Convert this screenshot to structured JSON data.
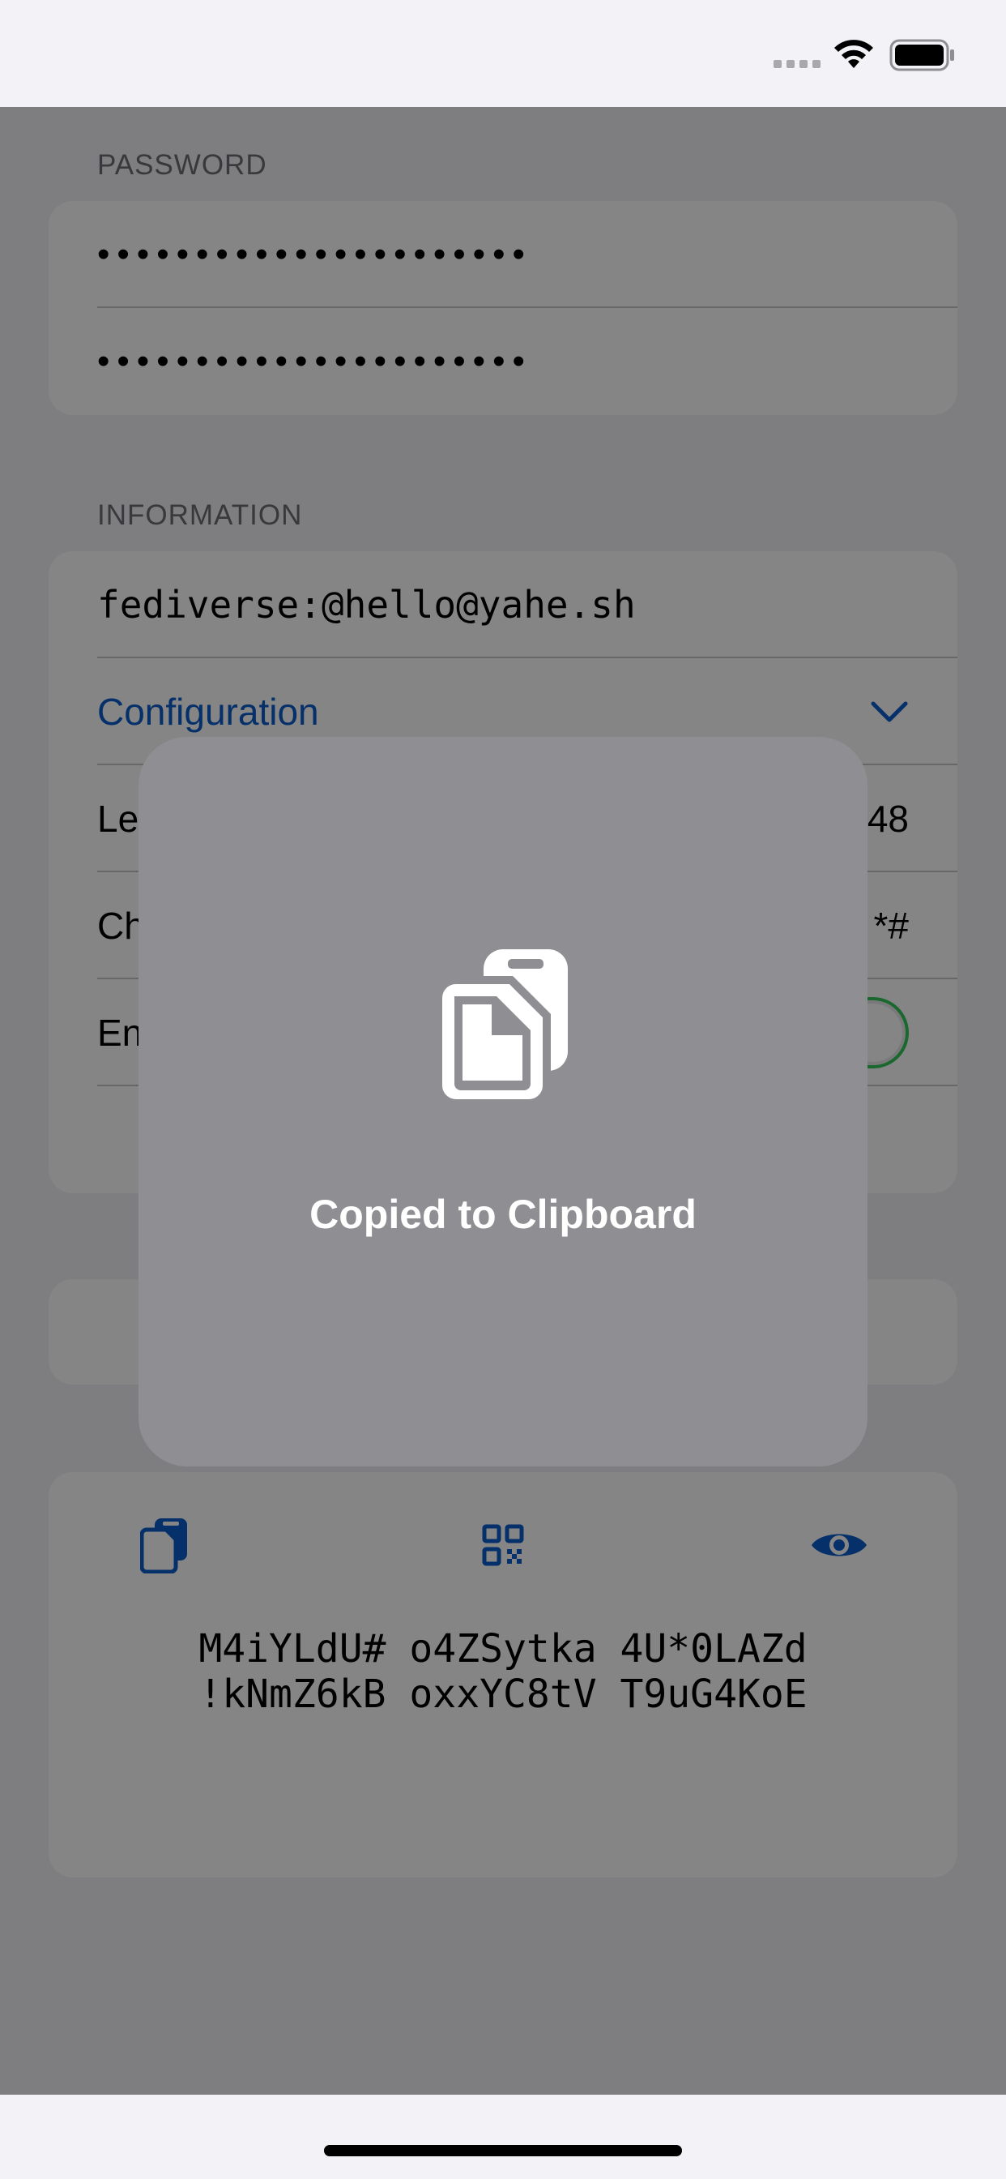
{
  "status_bar": {
    "signal_icon": "cellular-signal-icon",
    "wifi_icon": "wifi-icon",
    "battery_icon": "battery-icon"
  },
  "password_section": {
    "header": "PASSWORD",
    "field1": "••••••••••••••••••••••",
    "field2": "••••••••••••••••••••••"
  },
  "information_section": {
    "header": "INFORMATION",
    "account": "fediverse:@hello@yahe.sh",
    "configuration_label": "Configuration",
    "length_label": "Le",
    "length_value": "48",
    "characters_label": "Ch",
    "characters_value": "*#",
    "enabled_label": "En",
    "enabled_state": true
  },
  "output_section": {
    "copy_icon": "copy-icon",
    "qr_icon": "qr-code-icon",
    "reveal_icon": "eye-icon",
    "password_line1": "M4iYLdU# o4ZSytka 4U*0LAZd",
    "password_line2": "!kNmZ6kB oxxYC8tV T9uG4KoE"
  },
  "hud": {
    "icon": "clipboard-copy-icon",
    "message": "Copied to Clipboard"
  },
  "colors": {
    "accent": "#0a5ccc",
    "toggle_on": "#34c759",
    "hud_background": "#8e8e93"
  }
}
